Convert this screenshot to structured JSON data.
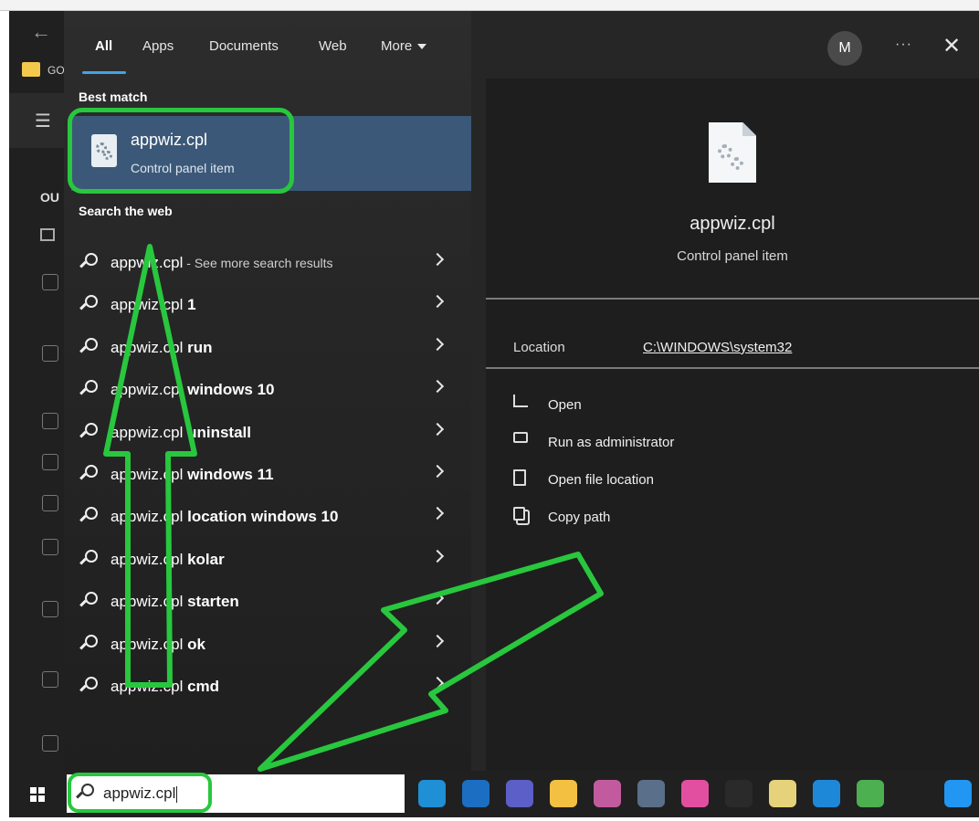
{
  "background": {
    "folder_label": "GO",
    "outline_label": "OU"
  },
  "tabs": [
    {
      "label": "All"
    },
    {
      "label": "Apps"
    },
    {
      "label": "Documents"
    },
    {
      "label": "Web"
    },
    {
      "label": "More"
    }
  ],
  "user_avatar_initial": "M",
  "more_options_label": "···",
  "best_match": {
    "section_label": "Best match",
    "title": "appwiz.cpl",
    "subtitle": "Control panel item"
  },
  "search_the_web": {
    "section_label": "Search the web",
    "results": [
      {
        "prefix": "appwiz.cpl",
        "suffix": " - See more search results"
      },
      {
        "prefix": "appwiz.cpl",
        "bold": " 1"
      },
      {
        "prefix": "appwiz.cpl",
        "bold": " run"
      },
      {
        "prefix": "appwiz.cpl",
        "bold": " windows 10"
      },
      {
        "prefix": "appwiz.cpl",
        "bold": " uninstall"
      },
      {
        "prefix": "appwiz.cpl",
        "bold": " windows 11"
      },
      {
        "prefix": "appwiz.cpl",
        "bold": " location windows 10"
      },
      {
        "prefix": "appwiz.cpl",
        "bold": " kolar"
      },
      {
        "prefix": "appwiz.cpl",
        "bold": " starten"
      },
      {
        "prefix": "appwiz.cpl",
        "bold": " ok"
      },
      {
        "prefix": "appwiz.cpl",
        "bold": " cmd"
      }
    ]
  },
  "details": {
    "title": "appwiz.cpl",
    "subtitle": "Control panel item",
    "location_label": "Location",
    "location_value": "C:\\WINDOWS\\system32",
    "actions": [
      {
        "label": "Open",
        "icon": "open-icon"
      },
      {
        "label": "Run as administrator",
        "icon": "run-as-admin-icon"
      },
      {
        "label": "Open file location",
        "icon": "folder-location-icon"
      },
      {
        "label": "Copy path",
        "icon": "copy-path-icon"
      }
    ]
  },
  "taskbar": {
    "search_value": "appwiz.cpl",
    "apps": [
      {
        "icon": "edge-icon",
        "color": "#1f8fd6"
      },
      {
        "icon": "outlook-icon",
        "color": "#1b6ec2"
      },
      {
        "icon": "teams-icon",
        "color": "#5b5fc7"
      },
      {
        "icon": "file-explorer-icon",
        "color": "#f3c041"
      },
      {
        "icon": "snipping-tool-icon",
        "color": "#c25b9e"
      },
      {
        "icon": "calculator-icon",
        "color": "#5a6f8a"
      },
      {
        "icon": "paint-icon",
        "color": "#e24fa0"
      },
      {
        "icon": "g-app-icon",
        "color": "#2a2a2a"
      },
      {
        "icon": "sticky-app-icon",
        "color": "#e6d27a"
      },
      {
        "icon": "azure-icon",
        "color": "#1e88d8"
      },
      {
        "icon": "notepad-icon",
        "color": "#4caf50"
      },
      {
        "icon": "settings-gear-icon",
        "color": "#202020"
      },
      {
        "icon": "person-app-icon",
        "color": "#2196f3"
      }
    ]
  },
  "accent_colors": {
    "annotation_green": "#28c73e",
    "selected_blue": "#3b5878",
    "tab_underline": "#3fa4e8"
  }
}
